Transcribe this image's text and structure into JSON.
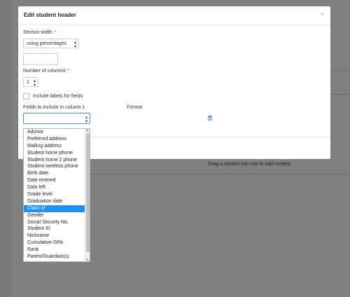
{
  "modal": {
    "title": "Edit student header",
    "close_glyph": "×"
  },
  "section_width": {
    "label": "Section width",
    "required_mark": "*",
    "value": "using percentages"
  },
  "number_of_columns": {
    "label": "Number of columns",
    "required_mark": "*",
    "value": "1"
  },
  "include_labels": {
    "label": "Include labels for fields",
    "checked": false
  },
  "fields": {
    "column_header": "Fields to include in column 1",
    "format_header": "Format",
    "selected_value": ""
  },
  "background": {
    "hint": "Drag a section into row to add content."
  },
  "dropdown": {
    "options": [
      "Advisor",
      "Preferred address",
      "Mailing address",
      "Student home phone",
      "Student home 2 phone",
      "Student wireless phone",
      "Birth date",
      "Date entered",
      "Date left",
      "Grade level",
      "Graduation date",
      "Class of",
      "Gender",
      "Social Security No.",
      "Student ID",
      "Nickname",
      "Cumulative GPA",
      "Rank",
      "Parent/Guardian(s)"
    ],
    "highlighted": "Class of"
  },
  "colors": {
    "highlight": "#1e90ff",
    "required": "#d9534f",
    "focus_border": "#4a90d9"
  }
}
